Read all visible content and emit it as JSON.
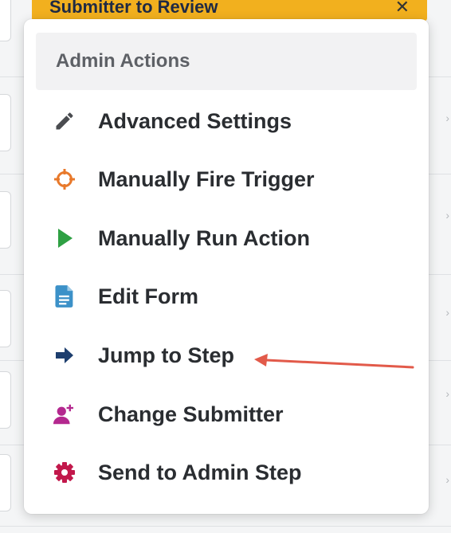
{
  "top_bar": {
    "label": "Submitter to Review",
    "close_glyph": "✕"
  },
  "menu": {
    "header": "Admin Actions",
    "items": [
      {
        "label": "Advanced Settings",
        "icon": "pencil-icon",
        "color": "#4a4c50"
      },
      {
        "label": "Manually Fire Trigger",
        "icon": "crosshair-icon",
        "color": "#e8792b"
      },
      {
        "label": "Manually Run Action",
        "icon": "play-icon",
        "color": "#2ea043"
      },
      {
        "label": "Edit Form",
        "icon": "document-icon",
        "color": "#3c91c8"
      },
      {
        "label": "Jump to Step",
        "icon": "arrow-right-icon",
        "color": "#1d3e6e"
      },
      {
        "label": "Change Submitter",
        "icon": "user-plus-icon",
        "color": "#b4288f"
      },
      {
        "label": "Send to Admin Step",
        "icon": "gear-icon",
        "color": "#c2184b"
      }
    ]
  },
  "annotation": {
    "color": "#e25a4a"
  }
}
